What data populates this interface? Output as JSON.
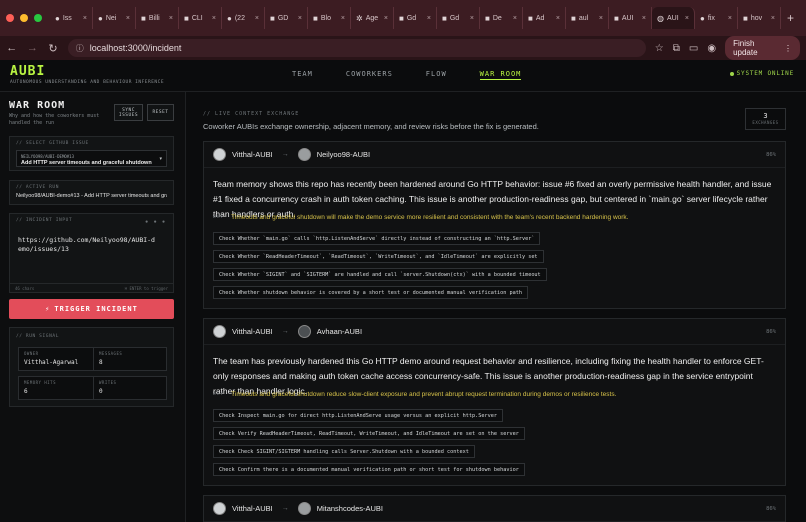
{
  "browser": {
    "tabs": [
      {
        "label": "Iss",
        "icon": "github-icon"
      },
      {
        "label": "Nei",
        "icon": "github-icon"
      },
      {
        "label": "Billi",
        "icon": "doc-icon"
      },
      {
        "label": "CLI",
        "icon": "doc-icon"
      },
      {
        "label": "(22",
        "icon": "whatsapp-icon"
      },
      {
        "label": "GD",
        "icon": "doc-icon"
      },
      {
        "label": "Blo",
        "icon": "doc-icon"
      },
      {
        "label": "Age",
        "icon": "gear-icon"
      },
      {
        "label": "Gd",
        "icon": "doc-icon"
      },
      {
        "label": "Gd",
        "icon": "doc-icon"
      },
      {
        "label": "De",
        "icon": "doc-icon"
      },
      {
        "label": "Ad",
        "icon": "doc-icon"
      },
      {
        "label": "aul",
        "icon": "doc-icon"
      },
      {
        "label": "AUI",
        "icon": "doc-icon"
      },
      {
        "label": "AUI",
        "icon": "globe-icon",
        "active": true
      },
      {
        "label": "fix",
        "icon": "github-icon"
      },
      {
        "label": "hov",
        "icon": "doc-icon"
      }
    ],
    "url": "localhost:3000/incident",
    "finish_update": "Finish update"
  },
  "app": {
    "logo": "AUBI",
    "logo_sub": "AUTONOMOUS UNDERSTANDING AND BEHAVIOUR INFERENCE",
    "nav": [
      "TEAM",
      "COWORKERS",
      "FLOW",
      "WAR ROOM"
    ],
    "status": "SYSTEM ONLINE",
    "accent": "#b9f542"
  },
  "sidebar": {
    "title": "WAR ROOM",
    "subtitle": "Why and how the coworkers must handled the run",
    "sync_label": "SYNC ISSUES",
    "reset_label": "RESET",
    "select_label": "// SELECT GITHUB ISSUE",
    "select_top": "NEILYOO98/AUBI-DEMO#13",
    "select_value": "Add HTTP server timeouts and graceful shutdown",
    "active_run_label": "// ACTIVE RUN",
    "active_run_value": "Neilyoo98/AUBI-demo#13 - Add HTTP server timeouts and graceful shutdown",
    "incident_label": "// INCIDENT INPUT",
    "incident_text": "https://github.com/Neilyoo98/AUBI-demo/issues/13",
    "incident_left": "46 chars",
    "incident_right": "⌘ ENTER to trigger",
    "trigger_label": "TRIGGER INCIDENT",
    "signal_label": "// RUN SIGNAL",
    "stats": [
      {
        "k": "OWNER",
        "v": "Vitthal-Agarwal"
      },
      {
        "k": "MESSAGES",
        "v": "8"
      },
      {
        "k": "MEMORY HITS",
        "v": "6"
      },
      {
        "k": "WRITES",
        "v": "0"
      }
    ]
  },
  "main": {
    "ctx_label": "// LIVE CONTEXT EXCHANGE",
    "ctx_sub": "Coworker AUBIs exchange ownership, adjacent memory, and review risks before the fix is generated.",
    "exchanges_count": "3",
    "exchanges_label": "EXCHANGES",
    "why_key": "WHY",
    "cards": [
      {
        "from": "Vitthal-AUBI",
        "to": "Neilyoo98-AUBI",
        "pct": "86%",
        "body": "Team memory shows this repo has recently been hardened around Go HTTP behavior: issue #6 fixed an overly permissive health handler, and issue #1 fixed a concurrency crash in auth token caching. This issue is another production-readiness gap, but centered in `main.go` server lifecycle rather than handlers or auth.",
        "why": "Timeouts and graceful shutdown will make the demo service more resilient and consistent with the team's recent backend hardening work.",
        "checks": [
          "Check Whether `main.go` calls `http.ListenAndServe` directly instead of constructing an `http.Server`",
          "Check Whether `ReadHeaderTimeout`, `ReadTimeout`, `WriteTimeout`, and `IdleTimeout` are explicitly set",
          "Check Whether `SIGINT` and `SIGTERM` are handled and call `server.Shutdown(ctx)` with a bounded timeout",
          "Check Whether shutdown behavior is covered by a short test or documented manual verification path"
        ]
      },
      {
        "from": "Vitthal-AUBI",
        "to": "Avhaan-AUBI",
        "pct": "86%",
        "body": "The team has previously hardened this Go HTTP demo around request behavior and resilience, including fixing the health handler to enforce GET-only responses and making auth token cache access concurrency-safe. This issue is another production-readiness gap in the service entrypoint rather than handler logic.",
        "why": "Timeouts and graceful shutdown reduce slow-client exposure and prevent abrupt request termination during demos or resilience tests.",
        "checks": [
          "Check Inspect main.go for direct http.ListenAndServe usage versus an explicit http.Server",
          "Check Verify ReadHeaderTimeout, ReadTimeout, WriteTimeout, and IdleTimeout are set on the server",
          "Check Check SIGINT/SIGTERM handling calls Server.Shutdown with a bounded context",
          "Check Confirm there is a documented manual verification path or short test for shutdown behavior"
        ]
      },
      {
        "from": "Vitthal-AUBI",
        "to": "Mitanshcodes-AUBI",
        "pct": "86%"
      }
    ]
  }
}
